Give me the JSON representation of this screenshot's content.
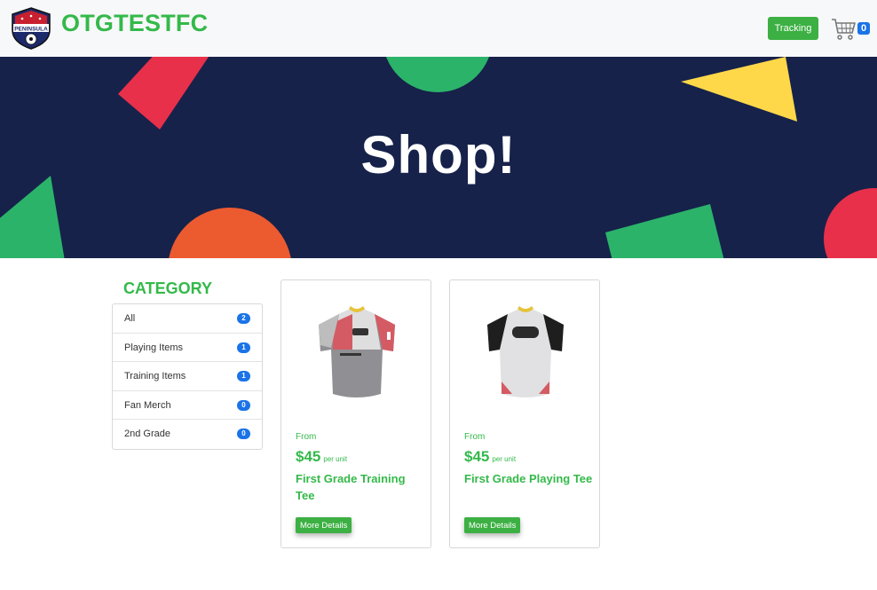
{
  "header": {
    "logo_text": "PENINSULA",
    "brand": "OTGTESTFC",
    "tracking_label": "Tracking",
    "cart_count": "0"
  },
  "hero": {
    "title": "Shop!"
  },
  "category": {
    "title": "CATEGORY",
    "items": [
      {
        "label": "All",
        "count": "2"
      },
      {
        "label": "Playing Items",
        "count": "1"
      },
      {
        "label": "Training Items",
        "count": "1"
      },
      {
        "label": "Fan Merch",
        "count": "0"
      },
      {
        "label": "2nd Grade",
        "count": "0"
      }
    ]
  },
  "products": [
    {
      "from": "From",
      "price": "$45",
      "per_unit": "per unit",
      "name": "First Grade Training Tee",
      "button": "More Details"
    },
    {
      "from": "From",
      "price": "$45",
      "per_unit": "per unit",
      "name": "First Grade Playing Tee",
      "button": "More Details"
    }
  ],
  "colors": {
    "brand_green": "#34b94a",
    "hero_bg": "#16224a",
    "badge_blue": "#1a73e8"
  }
}
